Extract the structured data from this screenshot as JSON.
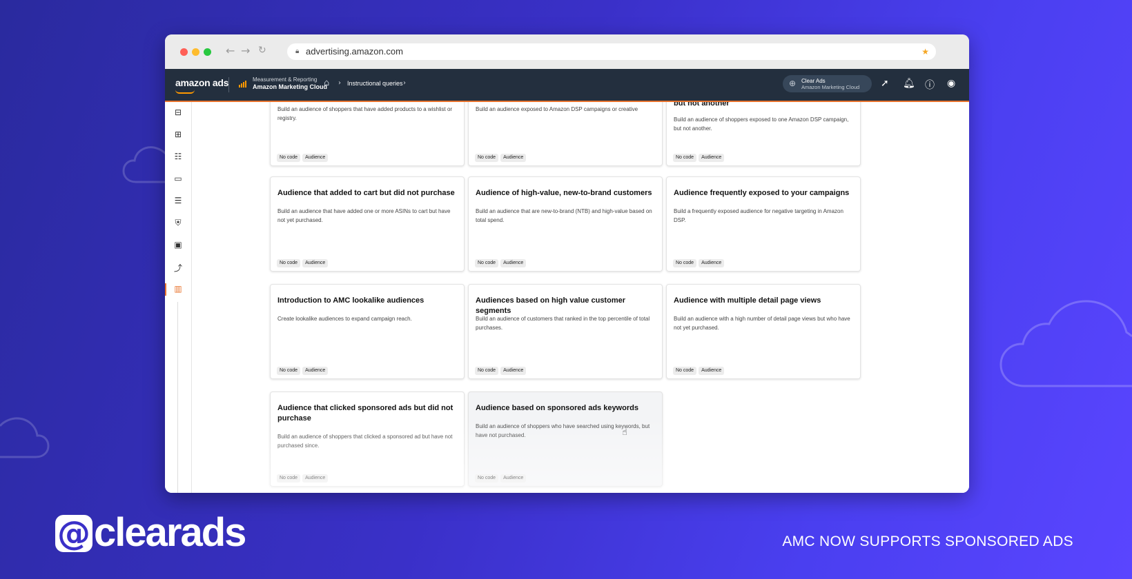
{
  "browser": {
    "url": "advertising.amazon.com"
  },
  "topnav": {
    "logo": "amazon ads",
    "section_top": "Measurement & Reporting",
    "section_main": "Amazon Marketing Cloud",
    "breadcrumb": "Instructional queries",
    "account_name": "Clear Ads",
    "account_sub": "Amazon Marketing Cloud"
  },
  "cards": [
    {
      "title": "",
      "desc": "Build an audience of shoppers that have added products to a wishlist or registry.",
      "tags": [
        "No code",
        "Audience"
      ]
    },
    {
      "title": "",
      "desc": "Build an audience exposed to Amazon DSP campaigns or creative",
      "tags": [
        "No code",
        "Audience"
      ]
    },
    {
      "title": "but not another",
      "desc": "Build an audience of shoppers exposed to one Amazon DSP campaign, but not another.",
      "tags": [
        "No code",
        "Audience"
      ]
    },
    {
      "title": "Audience that added to cart but did not purchase",
      "desc": "Build an audience that have added one or more ASINs to cart but have not yet purchased.",
      "tags": [
        "No code",
        "Audience"
      ]
    },
    {
      "title": "Audience of high-value, new-to-brand customers",
      "desc": "Build an audience that are new-to-brand (NTB) and high-value based on total spend.",
      "tags": [
        "No code",
        "Audience"
      ]
    },
    {
      "title": "Audience frequently exposed to your campaigns",
      "desc": "Build a frequently exposed audience for negative targeting in Amazon DSP.",
      "tags": [
        "No code",
        "Audience"
      ]
    },
    {
      "title": "Introduction to AMC lookalike audiences",
      "desc": "Create lookalike audiences to expand campaign reach.",
      "tags": [
        "No code",
        "Audience"
      ]
    },
    {
      "title": "Audiences based on high value customer segments",
      "desc": "Build an audience of customers that ranked in the top percentile of total purchases.",
      "tags": [
        "No code",
        "Audience"
      ]
    },
    {
      "title": "Audience with multiple detail page views",
      "desc": "Build an audience with a high number of detail page views but who have not yet purchased.",
      "tags": [
        "No code",
        "Audience"
      ]
    },
    {
      "title": "Audience that clicked sponsored ads but did not purchase",
      "desc": "Build an audience of shoppers that clicked a sponsored ad but have not purchased since.",
      "tags": [
        "No code",
        "Audience"
      ]
    },
    {
      "title": "Audience based on sponsored ads keywords",
      "desc": "Build an audience of shoppers who have searched using keywords, but have not purchased.",
      "tags": [
        "No code",
        "Audience"
      ]
    }
  ],
  "branding": {
    "logo_text": "clearads",
    "tagline": "AMC NOW SUPPORTS SPONSORED ADS"
  },
  "colors": {
    "nav_bg": "#232f3e",
    "accent_orange": "#e8742f",
    "background_purple": "#3a30c8"
  }
}
